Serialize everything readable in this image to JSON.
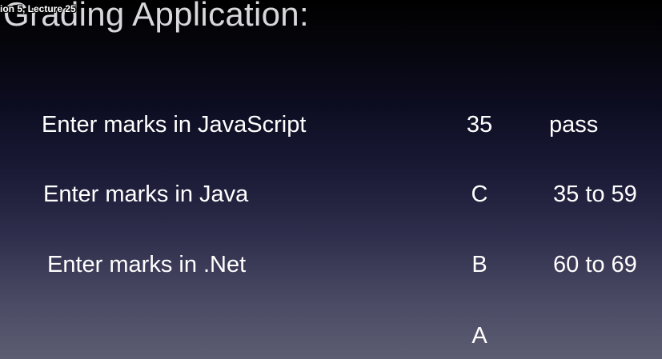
{
  "slide": {
    "title": "Grading Application:",
    "lecture_label": "ion 5, Lecture 25"
  },
  "rows": [
    {
      "label": "Enter marks in JavaScript",
      "value": "35",
      "grade": "pass"
    },
    {
      "label": "Enter marks in Java",
      "value": "C",
      "grade": "35 to 59"
    },
    {
      "label": "Enter marks in .Net",
      "value": "B",
      "grade": "60 to 69"
    },
    {
      "label": "",
      "value": "A",
      "grade": ""
    }
  ]
}
